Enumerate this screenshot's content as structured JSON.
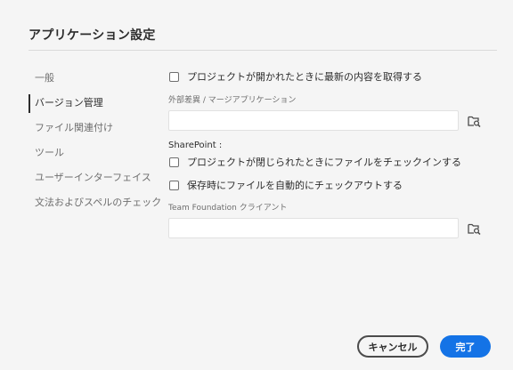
{
  "dialog": {
    "title": "アプリケーション設定"
  },
  "sidebar": {
    "items": [
      {
        "label": "一般",
        "active": false
      },
      {
        "label": "バージョン管理",
        "active": true
      },
      {
        "label": "ファイル関連付け",
        "active": false
      },
      {
        "label": "ツール",
        "active": false
      },
      {
        "label": "ユーザーインターフェイス",
        "active": false
      },
      {
        "label": "文法およびスペルのチェック",
        "active": false
      }
    ]
  },
  "main": {
    "open_latest_checkbox": {
      "label": "プロジェクトが開かれたときに最新の内容を取得する",
      "checked": false
    },
    "external_diff": {
      "label": "外部差異 / マージアプリケーション",
      "value": "",
      "placeholder": ""
    },
    "sharepoint": {
      "heading": "SharePoint :",
      "checkin_on_close": {
        "label": "プロジェクトが閉じられたときにファイルをチェックインする",
        "checked": false
      },
      "checkout_on_save": {
        "label": "保存時にファイルを自動的にチェックアウトする",
        "checked": false
      }
    },
    "tfs_client": {
      "label": "Team Foundation クライアント",
      "value": "",
      "placeholder": ""
    },
    "browse_icon": "folder-search-icon"
  },
  "footer": {
    "cancel_label": "キャンセル",
    "done_label": "完了"
  },
  "colors": {
    "background": "#f5f5f5",
    "accent": "#1473e6",
    "text": "#2c2c2c",
    "muted_text": "#6e6e6e"
  }
}
